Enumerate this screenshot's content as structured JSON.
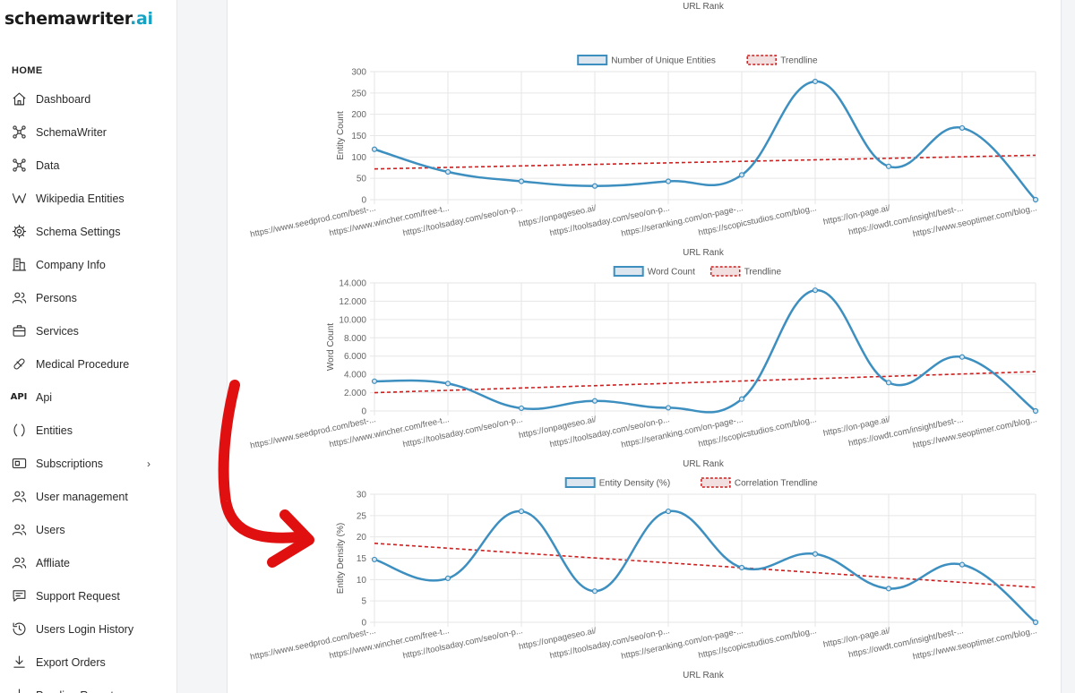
{
  "brand": {
    "name_main": "schemawriter",
    "name_suffix": ".ai"
  },
  "sidebar": {
    "section_label": "HOME",
    "items": [
      {
        "label": "Dashboard",
        "icon": "home-icon"
      },
      {
        "label": "SchemaWriter",
        "icon": "nodes-icon"
      },
      {
        "label": "Data",
        "icon": "nodes-icon"
      },
      {
        "label": "Wikipedia Entities",
        "icon": "wikipedia-icon"
      },
      {
        "label": "Schema Settings",
        "icon": "gear-icon"
      },
      {
        "label": "Company Info",
        "icon": "building-icon"
      },
      {
        "label": "Persons",
        "icon": "users-icon"
      },
      {
        "label": "Services",
        "icon": "briefcase-icon"
      },
      {
        "label": "Medical Procedure",
        "icon": "pill-icon"
      },
      {
        "label": "Api",
        "icon": "api-icon"
      },
      {
        "label": "Entities",
        "icon": "parentheses-icon"
      },
      {
        "label": "Subscriptions",
        "icon": "credit-card-icon",
        "has_submenu": true
      },
      {
        "label": "User management",
        "icon": "users-icon"
      },
      {
        "label": "Users",
        "icon": "users-icon"
      },
      {
        "label": "Affliate",
        "icon": "users-icon"
      },
      {
        "label": "Support Request",
        "icon": "message-icon"
      },
      {
        "label": "Users Login History",
        "icon": "history-icon"
      },
      {
        "label": "Export Orders",
        "icon": "download-icon"
      },
      {
        "label": "Pending Report",
        "icon": "download-icon"
      }
    ]
  },
  "top_axis_label": "URL Rank",
  "chart_data": [
    {
      "type": "line",
      "legend": [
        "Number of Unique Entities",
        "Trendline"
      ],
      "ylabel": "Entity Count",
      "xlabel": "URL Rank",
      "ylim": [
        0,
        300
      ],
      "yticks": [
        "0",
        "50",
        "100",
        "150",
        "200",
        "250",
        "300"
      ],
      "categories": [
        "https://www.seedprod.com/best-...",
        "https://www.wincher.com/free-t...",
        "https://toolsaday.com/seo/on-p...",
        "https://onpageseo.ai/",
        "https://toolsaday.com/seo/on-p...",
        "https://seranking.com/on-page-...",
        "https://scopicstudios.com/blog...",
        "https://on-page.ai/",
        "https://owdt.com/insight/best-...",
        "https://www.seoptimer.com/blog..."
      ],
      "values": [
        118,
        65,
        43,
        32,
        43,
        58,
        277,
        78,
        168,
        0
      ],
      "trend": [
        72,
        104
      ],
      "line_color": "#3d8fc0",
      "trend_color": "#cc1f1f"
    },
    {
      "type": "line",
      "legend": [
        "Word Count",
        "Trendline"
      ],
      "ylabel": "Word Count",
      "xlabel": "URL Rank",
      "ylim": [
        0,
        14000
      ],
      "yticks": [
        "0",
        "2.000",
        "4.000",
        "6.000",
        "8.000",
        "10.000",
        "12.000",
        "14.000"
      ],
      "categories": [
        "https://www.seedprod.com/best-...",
        "https://www.wincher.com/free-t...",
        "https://toolsaday.com/seo/on-p...",
        "https://onpageseo.ai/",
        "https://toolsaday.com/seo/on-p...",
        "https://seranking.com/on-page-...",
        "https://scopicstudios.com/blog...",
        "https://on-page.ai/",
        "https://owdt.com/insight/best-...",
        "https://www.seoptimer.com/blog..."
      ],
      "values": [
        3250,
        3000,
        300,
        1100,
        350,
        1300,
        13200,
        3100,
        5900,
        0
      ],
      "trend": [
        2000,
        4300
      ],
      "line_color": "#3d8fc0",
      "trend_color": "#cc1f1f"
    },
    {
      "type": "line",
      "legend": [
        "Entity Density (%)",
        "Correlation Trendline"
      ],
      "ylabel": "Entity Density (%)",
      "xlabel": "URL Rank",
      "ylim": [
        0,
        30
      ],
      "yticks": [
        "0",
        "5",
        "10",
        "15",
        "20",
        "25",
        "30"
      ],
      "categories": [
        "https://www.seedprod.com/best-...",
        "https://www.wincher.com/free-t...",
        "https://toolsaday.com/seo/on-p...",
        "https://onpageseo.ai/",
        "https://toolsaday.com/seo/on-p...",
        "https://seranking.com/on-page-...",
        "https://scopicstudios.com/blog...",
        "https://on-page.ai/",
        "https://owdt.com/insight/best-...",
        "https://www.seoptimer.com/blog..."
      ],
      "values": [
        14.7,
        10.3,
        26,
        7.3,
        26,
        12.8,
        16,
        7.9,
        13.5,
        0
      ],
      "trend": [
        18.5,
        8.2
      ],
      "line_color": "#3d8fc0",
      "trend_color": "#cc1f1f"
    }
  ],
  "annotation": {
    "arrow_color": "#e01010"
  }
}
